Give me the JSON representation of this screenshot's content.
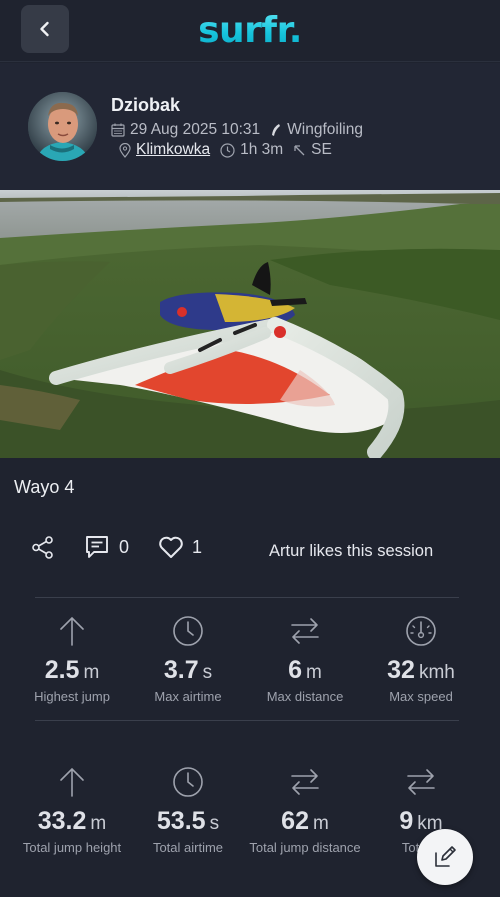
{
  "app": {
    "logo": "surfr."
  },
  "session": {
    "user": "Dziobak",
    "date": "29 Aug 2025 10:31",
    "sport": "Wingfoiling",
    "location": "Klimkowka",
    "duration": "1h 3m",
    "wind_direction": "SE",
    "title": "Wayo 4"
  },
  "social": {
    "comments": "0",
    "likes": "1",
    "likes_text": "Artur likes this session"
  },
  "stats_best": [
    {
      "icon": "arrow-up-icon",
      "value": "2.5",
      "unit": "m",
      "label": "Highest jump"
    },
    {
      "icon": "clock-icon",
      "value": "3.7",
      "unit": "s",
      "label": "Max airtime"
    },
    {
      "icon": "arrows-swap-icon",
      "value": "6",
      "unit": "m",
      "label": "Max distance"
    },
    {
      "icon": "speedometer-icon",
      "value": "32",
      "unit": "kmh",
      "label": "Max speed"
    }
  ],
  "stats_total": [
    {
      "icon": "arrow-up-icon",
      "value": "33.2",
      "unit": "m",
      "label": "Total jump height"
    },
    {
      "icon": "clock-icon",
      "value": "53.5",
      "unit": "s",
      "label": "Total airtime"
    },
    {
      "icon": "arrows-swap-icon",
      "value": "62",
      "unit": "m",
      "label": "Total jump distance"
    },
    {
      "icon": "arrows-swap-icon",
      "value": "9",
      "unit": "km",
      "label": "Total d"
    }
  ],
  "colors": {
    "background": "#1f232f",
    "logo": "#16c4dc",
    "fab": "#f3f4f6"
  }
}
